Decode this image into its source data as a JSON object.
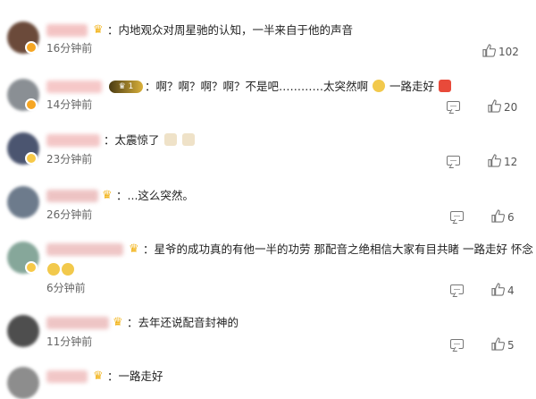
{
  "comments": [
    {
      "text": "内地观众对周星驰的认知，一半来自于他的声音",
      "time": "16分钟前",
      "likes": "102",
      "avatar_color": "#6b4a3a"
    },
    {
      "text": "啊？啊？啊？啊？不是吧…………太突然啊",
      "text2": "一路走好",
      "time": "14分钟前",
      "likes": "20",
      "avatar_color": "#8a8f94",
      "level": "1"
    },
    {
      "text": "太震惊了",
      "time": "23分钟前",
      "likes": "12",
      "avatar_color": "#4b5570"
    },
    {
      "text": "...这么突然。",
      "time": "26分钟前",
      "likes": "6",
      "avatar_color": "#6d7b8c"
    },
    {
      "text": "星爷的成功真的有他一半的功劳 那配音之绝相信大家有目共睹 一路走好 怀念",
      "time": "6分钟前",
      "likes": "4",
      "avatar_color": "#86a79a"
    },
    {
      "text": "去年还说配音封神的",
      "time": "11分钟前",
      "likes": "5",
      "avatar_color": "#4e4e4e"
    },
    {
      "text": "一路走好",
      "avatar_color": "#8d8d8d"
    }
  ],
  "colors": {
    "nick_blur": "#f0a3a3",
    "crown": "#f2b318",
    "badge": "#f6a623"
  }
}
